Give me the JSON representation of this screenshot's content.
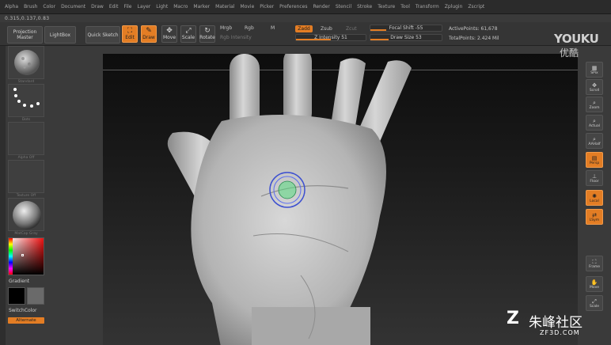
{
  "menu": [
    "Alpha",
    "Brush",
    "Color",
    "Document",
    "Draw",
    "Edit",
    "File",
    "Layer",
    "Light",
    "Macro",
    "Marker",
    "Material",
    "Movie",
    "Picker",
    "Preferences",
    "Render",
    "Stencil",
    "Stroke",
    "Texture",
    "Tool",
    "Transform",
    "Zplugin",
    "Zscript"
  ],
  "coords": "0.315,0.137,0.83",
  "toolbar": {
    "projection_master": "Projection Master",
    "lightbox": "LightBox",
    "quick_sketch": "Quick Sketch",
    "edit": "Edit",
    "draw": "Draw",
    "move": "Move",
    "scale": "Scale",
    "rotate": "Rotate",
    "mrgb": "Mrgb",
    "rgb": "Rgb",
    "m": "M",
    "rgb_intensity": "Rgb Intensity",
    "zadd": "Zadd",
    "zsub": "Zsub",
    "zcut": "Zcut",
    "z_intensity": "Z Intensity 51",
    "focal_shift": "Focal Shift -55",
    "draw_size": "Draw Size 53",
    "active_points": "ActivePoints: 61,678",
    "total_points": "TotalPoints: 2.424 Mil"
  },
  "left_palette": {
    "labels": [
      "Standard",
      "Dots",
      "Alpha Off",
      "Texture Off",
      "MatCap Gray"
    ],
    "gradient": "Gradient",
    "switch_color": "SwitchColor",
    "alternate": "Alternate"
  },
  "right_shelf": [
    "SPix",
    "Scroll",
    "Zoom",
    "Actual",
    "AAHalf",
    "Persp",
    "Floor",
    "Local",
    "LSym",
    "Frame",
    "Move",
    "Scale"
  ],
  "watermarks": {
    "youku_latin": "YOUKU",
    "youku_cjk": "优酷",
    "zf_mark": "Z",
    "zf_name": "朱峰社区",
    "zf_url": "ZF3D.COM"
  },
  "colors": {
    "accent": "#e37d24",
    "background": "#3a3a3a",
    "canvas": "#1a1a1a"
  }
}
